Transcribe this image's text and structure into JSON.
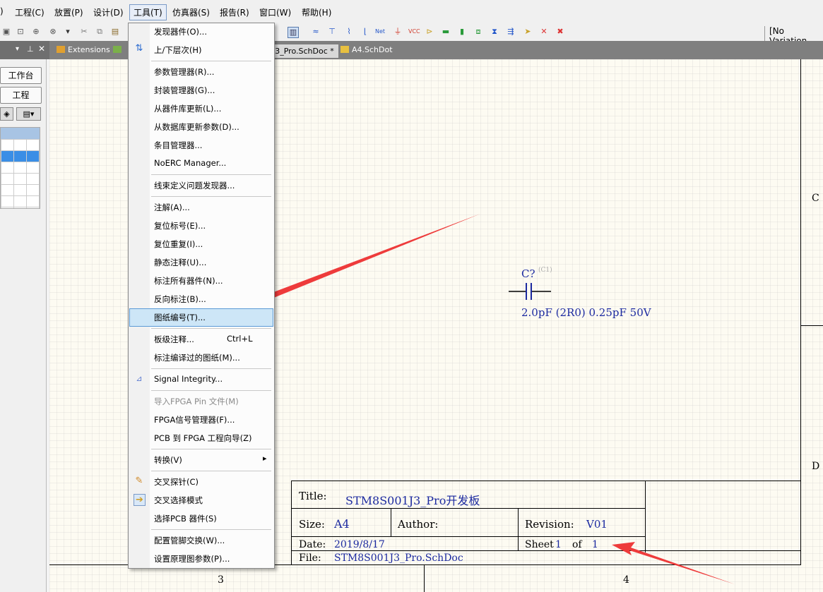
{
  "menubar": {
    "items": [
      ")",
      "工程(C)",
      "放置(P)",
      "设计(D)",
      "工具(T)",
      "仿真器(S)",
      "报告(R)",
      "窗口(W)",
      "帮助(H)"
    ],
    "variation": "[No Variation"
  },
  "tabs": {
    "extensions": "Extensions",
    "current": "J3_Pro.SchDoc *",
    "other": "A4.SchDot"
  },
  "left_panel": {
    "workbench_button": "工作台",
    "project_button": "工程"
  },
  "tools_menu": {
    "items": [
      "发现器件(O)...",
      "上/下层次(H)",
      "参数管理器(R)...",
      "封装管理器(G)...",
      "从器件库更新(L)...",
      "从数据库更新参数(D)...",
      "条目管理器...",
      "NoERC Manager...",
      "线束定义问题发现器...",
      "注解(A)...",
      "复位标号(E)...",
      "复位重复(I)...",
      "静态注释(U)...",
      "标注所有器件(N)...",
      "反向标注(B)...",
      "图纸编号(T)...",
      "板级注释...",
      "标注编译过的图纸(M)...",
      "Signal Integrity...",
      "导入FPGA Pin 文件(M)",
      "FPGA信号管理器(F)...",
      "PCB 到 FPGA 工程向导(Z)",
      "转换(V)",
      "交叉探针(C)",
      "交叉选择模式",
      "选择PCB 器件(S)",
      "配置管脚交换(W)...",
      "设置原理图参数(P)..."
    ],
    "shortcut_board": "Ctrl+L",
    "submenu_arrow": "▸"
  },
  "schematic": {
    "designator": "C?",
    "designator_hint": "(C1)",
    "value": "2.0pF (2R0) 0.25pF 50V",
    "zone_c": "C",
    "zone_d": "D",
    "col_3": "3",
    "col_4": "4"
  },
  "title_block": {
    "title_label": "Title:",
    "title_value": "STM8S001J3_Pro开发板",
    "size_label": "Size:",
    "size_value": "A4",
    "author_label": "Author:",
    "revision_label": "Revision:",
    "revision_value": "V01",
    "date_label": "Date:",
    "date_value": "2019/8/17",
    "sheet_label": "Sheet",
    "sheet_value": "1",
    "of_label": "of",
    "of_value": "1",
    "file_label": "File:",
    "file_value": "STM8S001J3_Pro.SchDoc"
  },
  "colors": {
    "annotation_arrow": "#ee3b3b",
    "schematic_text": "#1c2aa0",
    "menu_highlight": "#cde6f7"
  }
}
